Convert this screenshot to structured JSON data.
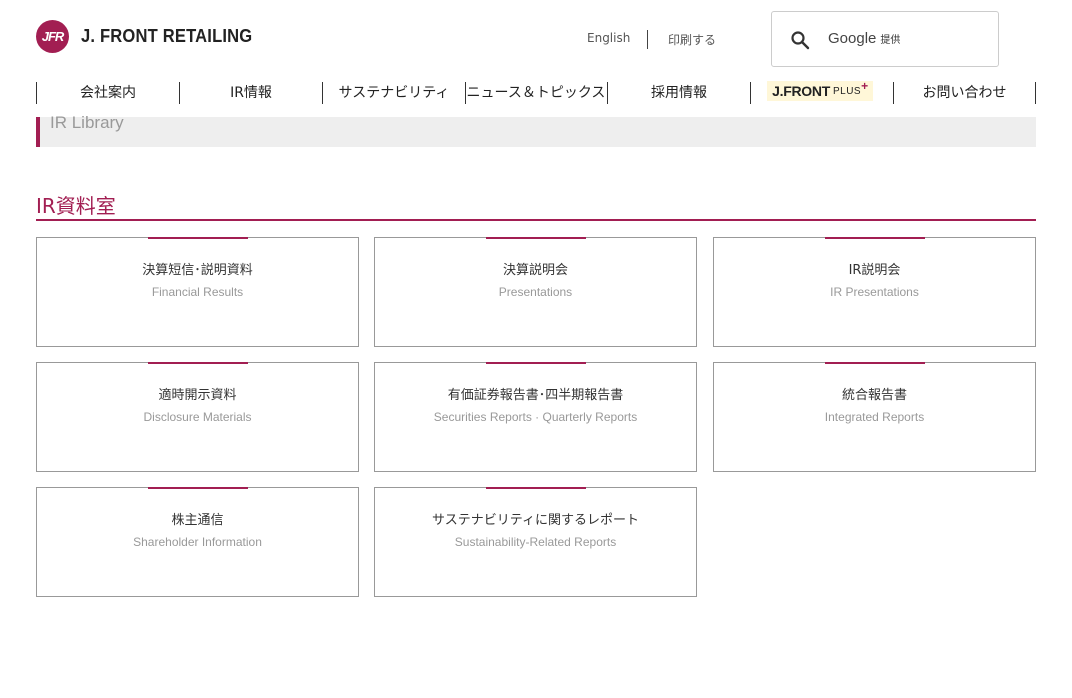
{
  "header": {
    "logo_mark": "JFR",
    "logo_text": "J. FRONT RETAILING",
    "english_link": "English",
    "print_link": "印刷する",
    "search": {
      "brand": "Google",
      "provided": "提供"
    }
  },
  "nav": {
    "items": [
      "会社案内",
      "IR情報",
      "サステナビリティ",
      "ニュース＆トピックス",
      "採用情報",
      {
        "brand": "J.FRONT",
        "plus": "PLUS",
        "sup": "+"
      },
      "お問い合わせ"
    ]
  },
  "breadcrumb": {
    "label": "IR Library"
  },
  "section": {
    "title": "IR資料室"
  },
  "cards": [
    {
      "jp": "決算短信･説明資料",
      "en": "Financial Results"
    },
    {
      "jp": "決算説明会",
      "en": "Presentations"
    },
    {
      "jp": "IR説明会",
      "en": "IR Presentations"
    },
    {
      "jp": "適時開示資料",
      "en": "Disclosure Materials"
    },
    {
      "jp": "有価証券報告書･四半期報告書",
      "en": "Securities Reports · Quarterly Reports"
    },
    {
      "jp": "統合報告書",
      "en": "Integrated Reports"
    },
    {
      "jp": "株主通信",
      "en": "Shareholder Information"
    },
    {
      "jp": "サステナビリティに関するレポート",
      "en": "Sustainability-Related Reports"
    }
  ],
  "colors": {
    "accent": "#a21e52",
    "band": "#eeeeee",
    "jfplus_bg": "#fff7d8"
  }
}
